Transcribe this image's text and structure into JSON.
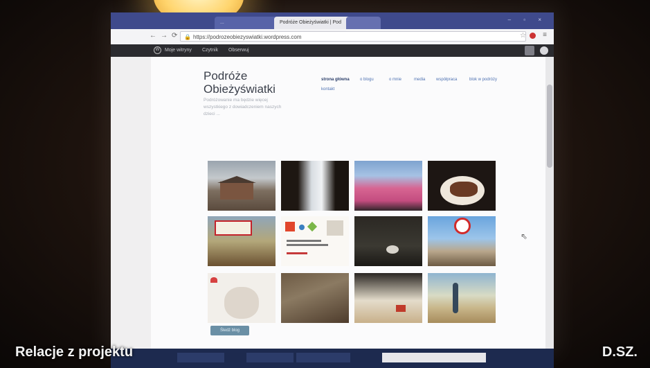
{
  "browser": {
    "tabs": [
      {
        "label": "...",
        "close": "×"
      },
      {
        "label": "Podróże Obieżyświatki | Pod",
        "close": "×"
      },
      {
        "label": "",
        "close": ""
      }
    ],
    "url": "https://podrozeobiezyswiatki.wordpress.com",
    "window_buttons": "– ▫ ×"
  },
  "wp_toolbar": {
    "items": [
      "Moje witryny",
      "Czytnik",
      "Obserwuj"
    ]
  },
  "site": {
    "title": "Podróże Obieżyświatki",
    "description": "Podróżowanie ma będzie więcej wszystkiego z dowiadczeniem naszych dzieci ...",
    "menu": [
      "strona główna",
      "o blogu",
      "o mnie",
      "media",
      "współpraca",
      "blok w podróży",
      "kontakt"
    ]
  },
  "follow_button": "Śledź blog",
  "colors": {
    "tabbar": "#3f4a8c",
    "link": "#4f72b2",
    "button": "#6a8fa5"
  },
  "captions": {
    "left": "Relacje z projektu",
    "right": "D.SZ."
  }
}
